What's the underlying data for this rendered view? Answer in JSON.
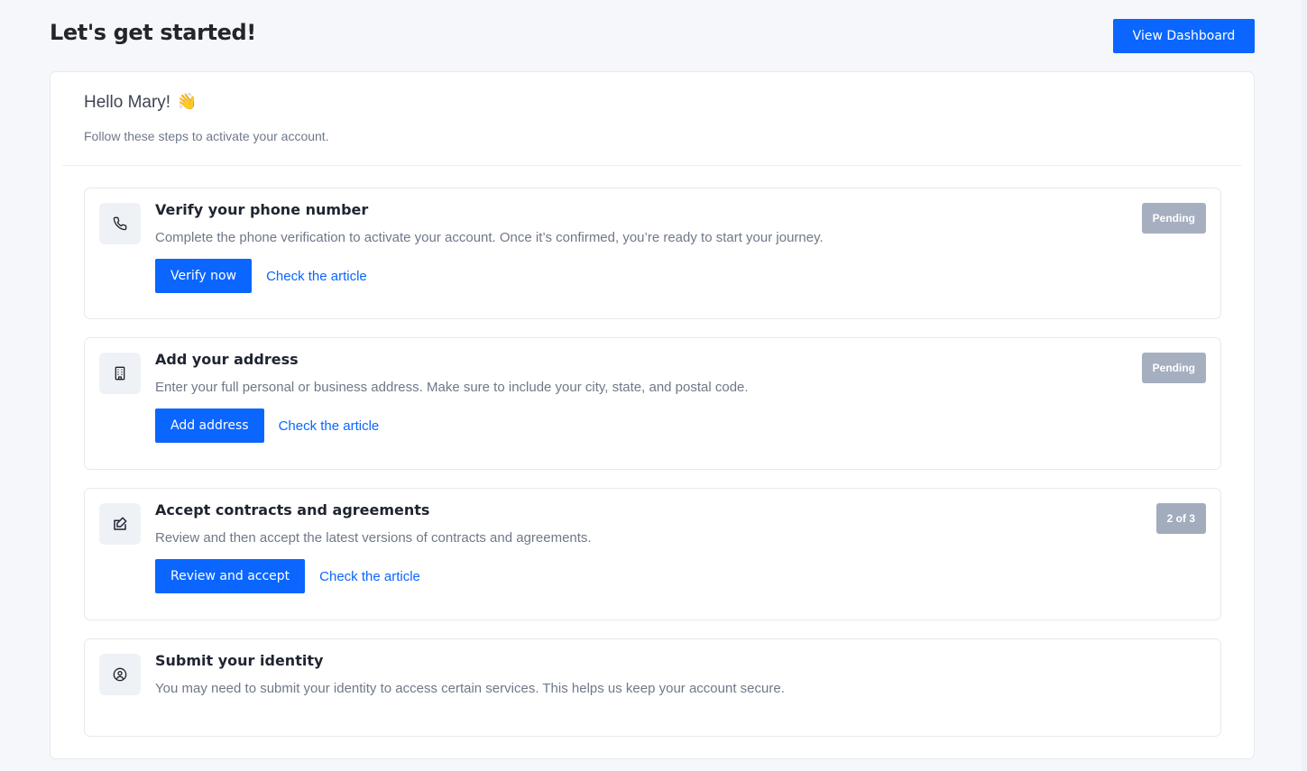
{
  "header": {
    "title": "Let's get started!",
    "view_dashboard_label": "View Dashboard"
  },
  "intro": {
    "greeting": "Hello Mary!",
    "greeting_emoji": "👋",
    "subtitle": "Follow these steps to activate your account."
  },
  "steps": [
    {
      "icon": "phone-icon",
      "title": "Verify your phone number",
      "description": "Complete the phone verification to activate your account. Once it’s confirmed, you’re ready to start your journey.",
      "action_label": "Verify now",
      "link_label": "Check the article",
      "badge": "Pending"
    },
    {
      "icon": "building-icon",
      "title": "Add your address",
      "description": "Enter your full personal or business address. Make sure to include your city, state, and postal code.",
      "action_label": "Add address",
      "link_label": "Check the article",
      "badge": "Pending"
    },
    {
      "icon": "edit-document-icon",
      "title": "Accept contracts and agreements",
      "description": "Review and then accept the latest versions of contracts and agreements.",
      "action_label": "Review and accept",
      "link_label": "Check the article",
      "badge": "2 of 3"
    },
    {
      "icon": "user-circle-icon",
      "title": "Submit your identity",
      "description": "You may need to submit your identity to access certain services. This helps us keep your account secure."
    }
  ],
  "colors": {
    "page_background": "#f5f7fb",
    "primary": "#0a66ff",
    "badge": "#a6afc0",
    "text_muted": "#6f7888"
  }
}
